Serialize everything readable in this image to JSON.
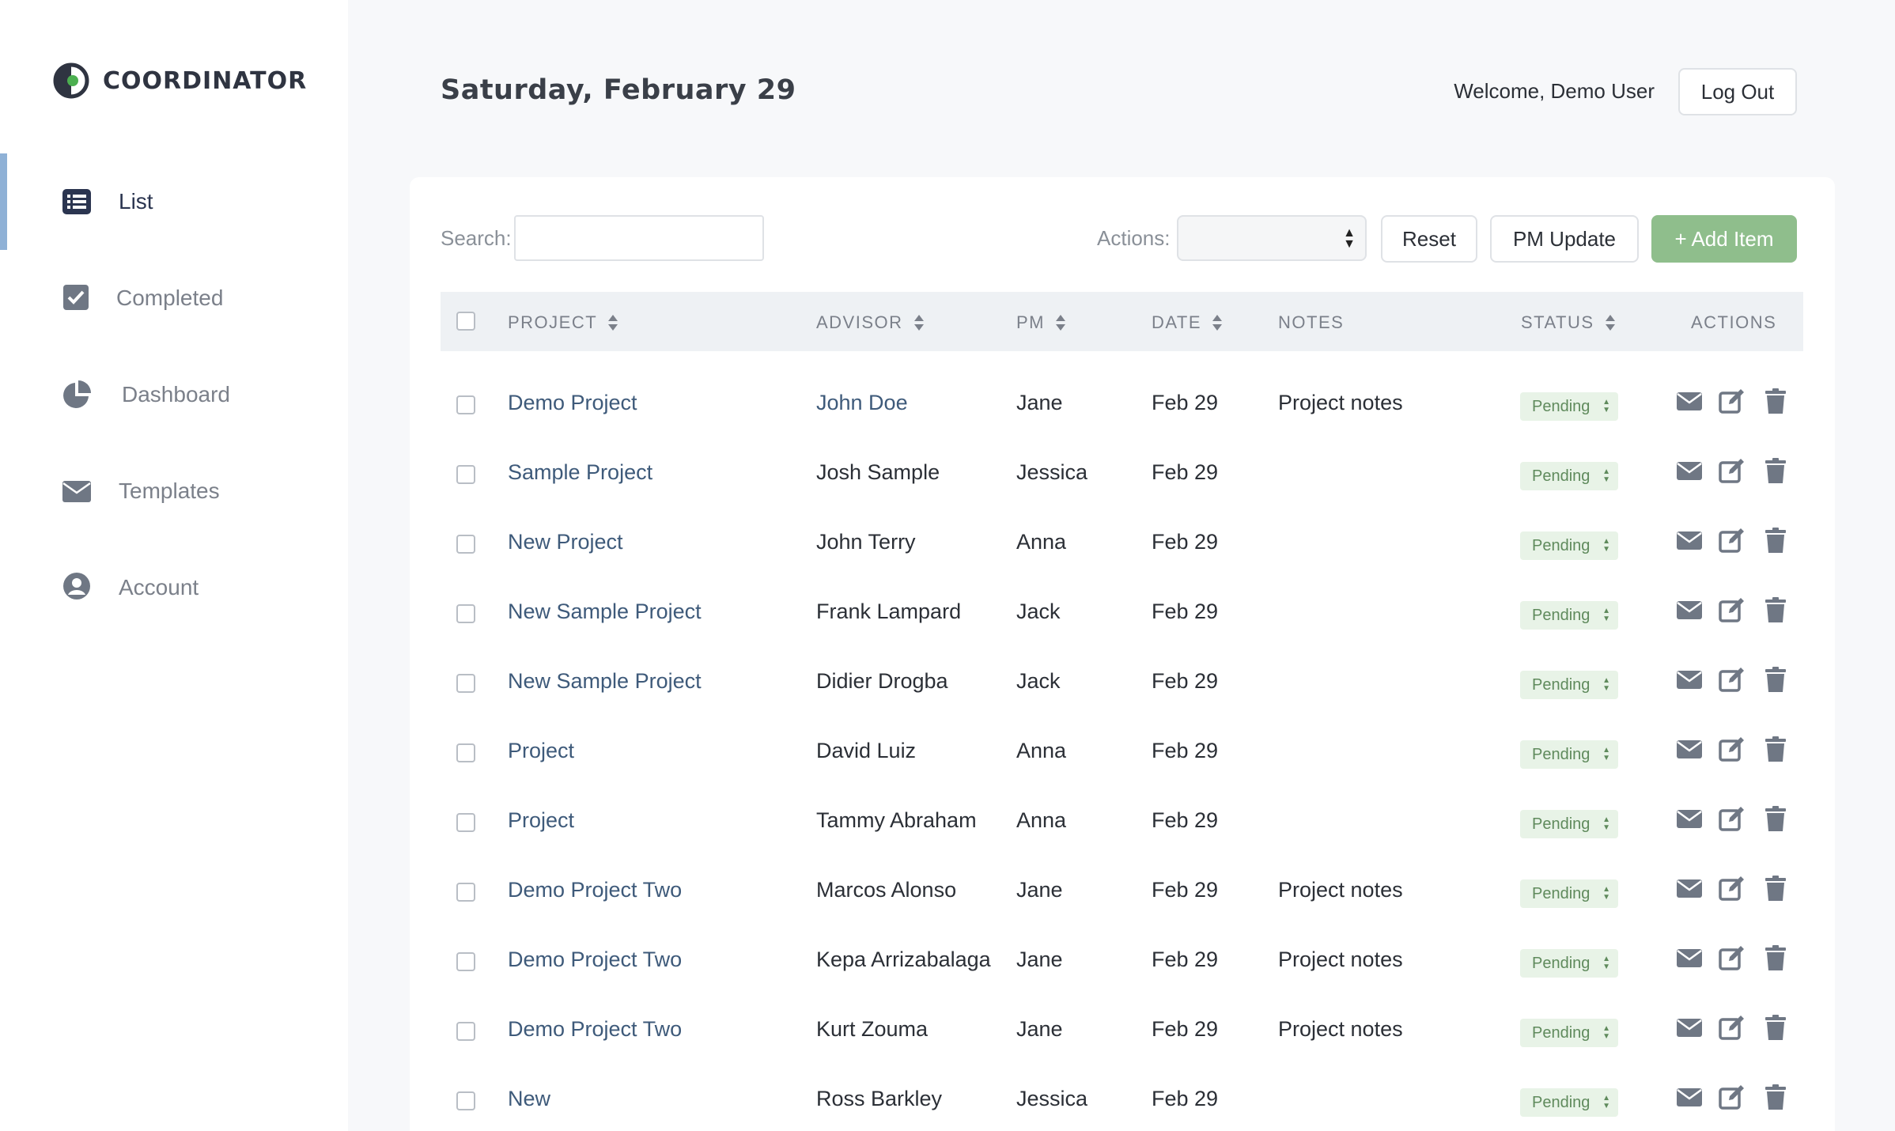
{
  "app": {
    "brand": "COORDINATOR"
  },
  "sidebar": {
    "items": [
      {
        "label": "List",
        "icon": "list-icon",
        "active": true
      },
      {
        "label": "Completed",
        "icon": "check-square-icon",
        "active": false
      },
      {
        "label": "Dashboard",
        "icon": "pie-chart-icon",
        "active": false
      },
      {
        "label": "Templates",
        "icon": "envelope-icon",
        "active": false
      },
      {
        "label": "Account",
        "icon": "user-circle-icon",
        "active": false
      }
    ]
  },
  "header": {
    "date_title": "Saturday, February 29",
    "welcome": "Welcome, Demo User",
    "logout_label": "Log Out"
  },
  "toolbar": {
    "search_label": "Search:",
    "search_value": "",
    "actions_label": "Actions:",
    "actions_selected": "",
    "reset_label": "Reset",
    "pm_update_label": "PM Update",
    "add_item_label": "+ Add Item"
  },
  "table": {
    "columns": [
      "PROJECT",
      "ADVISOR",
      "PM",
      "DATE",
      "NOTES",
      "STATUS",
      "ACTIONS"
    ],
    "rows": [
      {
        "project": "Demo Project",
        "advisor": "John Doe",
        "advisor_link": true,
        "pm": "Jane",
        "date": "Feb 29",
        "notes": "Project notes",
        "status": "Pending"
      },
      {
        "project": "Sample Project",
        "advisor": "Josh Sample",
        "advisor_link": false,
        "pm": "Jessica",
        "date": "Feb 29",
        "notes": "",
        "status": "Pending"
      },
      {
        "project": "New Project",
        "advisor": "John Terry",
        "advisor_link": false,
        "pm": "Anna",
        "date": "Feb 29",
        "notes": "",
        "status": "Pending"
      },
      {
        "project": "New Sample Project",
        "advisor": "Frank Lampard",
        "advisor_link": false,
        "pm": "Jack",
        "date": "Feb 29",
        "notes": "",
        "status": "Pending"
      },
      {
        "project": "New Sample Project",
        "advisor": "Didier Drogba",
        "advisor_link": false,
        "pm": "Jack",
        "date": "Feb 29",
        "notes": "",
        "status": "Pending"
      },
      {
        "project": "Project",
        "advisor": "David Luiz",
        "advisor_link": false,
        "pm": "Anna",
        "date": "Feb 29",
        "notes": "",
        "status": "Pending"
      },
      {
        "project": "Project",
        "advisor": "Tammy Abraham",
        "advisor_link": false,
        "pm": "Anna",
        "date": "Feb 29",
        "notes": "",
        "status": "Pending"
      },
      {
        "project": "Demo Project Two",
        "advisor": "Marcos Alonso",
        "advisor_link": false,
        "pm": "Jane",
        "date": "Feb 29",
        "notes": "Project notes",
        "status": "Pending"
      },
      {
        "project": "Demo Project Two",
        "advisor": "Kepa Arrizabalaga",
        "advisor_link": false,
        "pm": "Jane",
        "date": "Feb 29",
        "notes": "Project notes",
        "status": "Pending"
      },
      {
        "project": "Demo Project Two",
        "advisor": "Kurt Zouma",
        "advisor_link": false,
        "pm": "Jane",
        "date": "Feb 29",
        "notes": "Project notes",
        "status": "Pending"
      },
      {
        "project": "New",
        "advisor": "Ross Barkley",
        "advisor_link": false,
        "pm": "Jessica",
        "date": "Feb 29",
        "notes": "",
        "status": "Pending"
      }
    ],
    "row_actions": [
      "email-icon",
      "edit-icon",
      "trash-icon"
    ]
  },
  "colors": {
    "accent_green": "#8fbe8c",
    "link_blue": "#3e5a7a",
    "active_bar": "#8fb1d6",
    "status_bg": "#e8f3e7"
  }
}
